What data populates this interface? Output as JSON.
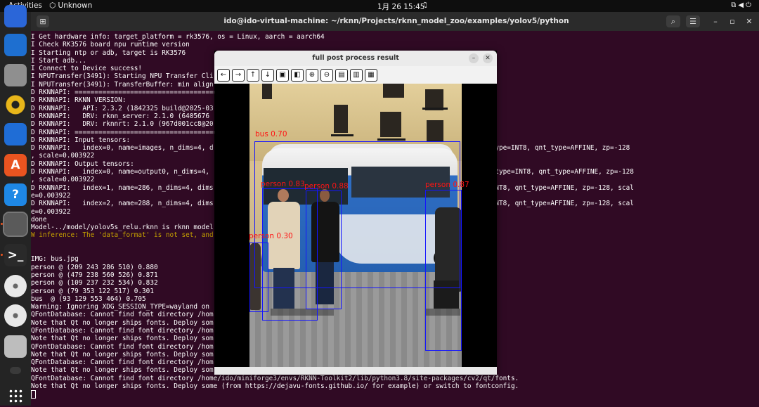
{
  "topbar": {
    "activities": "Activities",
    "app_indicator": "Unknown",
    "clock": "1月 26 15:45"
  },
  "dock": {
    "items": [
      {
        "name": "firefox",
        "label": "",
        "color": "#2b66d8"
      },
      {
        "name": "thunderbird",
        "label": "",
        "color": "#1e6fd0"
      },
      {
        "name": "files",
        "label": "",
        "color": "#8f8f8f"
      },
      {
        "name": "rhythmbox",
        "label": "",
        "color": "#e8b61a"
      },
      {
        "name": "libreoffice-writer",
        "label": "",
        "color": "#1f6dd6"
      },
      {
        "name": "app-center",
        "label": "A",
        "color": "#e95420"
      },
      {
        "name": "help",
        "label": "?",
        "color": "#1e88e5"
      },
      {
        "name": "settings",
        "label": "",
        "color": "#6a6a6a"
      },
      {
        "name": "terminal",
        "label": ">_",
        "color": "#2a2a2a"
      },
      {
        "name": "disc-1",
        "label": "",
        "color": "#cfcfcf"
      },
      {
        "name": "disc-2",
        "label": "",
        "color": "#cfcfcf"
      },
      {
        "name": "save-drive",
        "label": "",
        "color": "#bdbdbd"
      },
      {
        "name": "usb-drive",
        "label": "",
        "color": "#9e9e9e"
      },
      {
        "name": "show-apps",
        "label": "",
        "color": "#242424"
      }
    ]
  },
  "terminal": {
    "title": "ido@ido-virtual-machine: ~/rknn/Projects/rknn_model_zoo/examples/yolov5/python",
    "lines": [
      "I Get hardware info: target_platform = rk3576, os = Linux, aarch = aarch64",
      "I Check RK3576 board npu runtime version",
      "I Starting ntp or adb, target is RK3576",
      "I Start adb...",
      "I Connect to Device success!",
      "I NPUTransfer(3491): Starting NPU Transfer Cli",
      "I NPUTransfer(3491): TransferBuffer: min align",
      "D RKNNAPI: ==============================================",
      "D RKNNAPI: RKNN VERSION:",
      "D RKNNAPI:   API: 2.3.2 (1842325 build@2025-03",
      "D RKNNAPI:   DRV: rknn_server: 2.1.0 (6405676",
      "D RKNNAPI:   DRV: rknnrt: 2.1.0 (967d001cc8@20",
      "D RKNNAPI: ==============================================",
      "D RKNNAPI: Input tensors:",
      "D RKNNAPI:   index=0, name=images, n_dims=4, d                                          _with_stride = 0, fmt=NHWC, type=INT8, qnt_type=AFFINE, zp=-128",
      ", scale=0.003922",
      "D RKNNAPI: Output tensors:",
      "D RKNNAPI:   index=0, name=output0, n_dims=4,                                           e_with_stride = 0, fmt=NCHW, type=INT8, qnt_type=AFFINE, zp=-128",
      ", scale=0.003922",
      "D RKNNAPI:   index=1, name=286, n_dims=4, dims                                          _stride = 0, fmt=NCHW, type=INT8, qnt_type=AFFINE, zp=-128, scal",
      "e=0.003922",
      "D RKNNAPI:   index=2, name=288, n_dims=4, dims                                          _stride = 0, fmt=NCHW, type=INT8, qnt_type=AFFINE, zp=-128, scal",
      "e=0.003922",
      "done",
      "Model-../model/yolov5s_relu.rknn is rknn model",
      "W inference: The 'data_format' is not set, and",
      "",
      "",
      "IMG: bus.jpg",
      "person @ (209 243 286 510) 0.880",
      "person @ (479 238 560 526) 0.871",
      "person @ (109 237 232 534) 0.832",
      "person @ (79 353 122 517) 0.301",
      "bus  @ (93 129 553 464) 0.705",
      "Warning: Ignoring XDG_SESSION_TYPE=wayland on                                            ",
      "QFontDatabase: Cannot find font directory /hom                                          /fonts.",
      "Note that Qt no longer ships fonts. Deploy som                                          onfig.",
      "QFontDatabase: Cannot find font directory /hom                                          /fonts.",
      "Note that Qt no longer ships fonts. Deploy som                                          onfig.",
      "QFontDatabase: Cannot find font directory /hom                                          /fonts.",
      "Note that Qt no longer ships fonts. Deploy som                                          onfig.",
      "QFontDatabase: Cannot find font directory /hom                                          /fonts.",
      "Note that Qt no longer ships fonts. Deploy som                                          onfig.",
      "QFontDatabase: Cannot find font directory /home/ido/miniforge3/envs/RKNN-Toolkit2/lib/python3.8/site-packages/cv2/qt/fonts.",
      "Note that Qt no longer ships fonts. Deploy some (from https://dejavu-fonts.github.io/ for example) or switch to fontconfig."
    ],
    "warn_line_index": 25
  },
  "viewer": {
    "title": "full post process result",
    "toolbar": [
      "arrow-left-icon",
      "arrow-right-icon",
      "arrow-up-icon",
      "arrow-down-icon",
      "zoom-fit-icon",
      "zoom-region-icon",
      "zoom-in-icon",
      "zoom-out-icon",
      "save-icon",
      "properties-icon",
      "expand-panel-icon"
    ],
    "detections": [
      {
        "label": "bus 0.70",
        "class": "bus",
        "score": 0.7
      },
      {
        "label": "person 0.83",
        "class": "person",
        "score": 0.83
      },
      {
        "label": "person 0.88",
        "class": "person",
        "score": 0.88
      },
      {
        "label": "person 0.87",
        "class": "person",
        "score": 0.87
      },
      {
        "label": "person 0.30",
        "class": "person",
        "score": 0.3
      }
    ],
    "box_color": "#1414ff",
    "label_color": "#ff1414"
  }
}
